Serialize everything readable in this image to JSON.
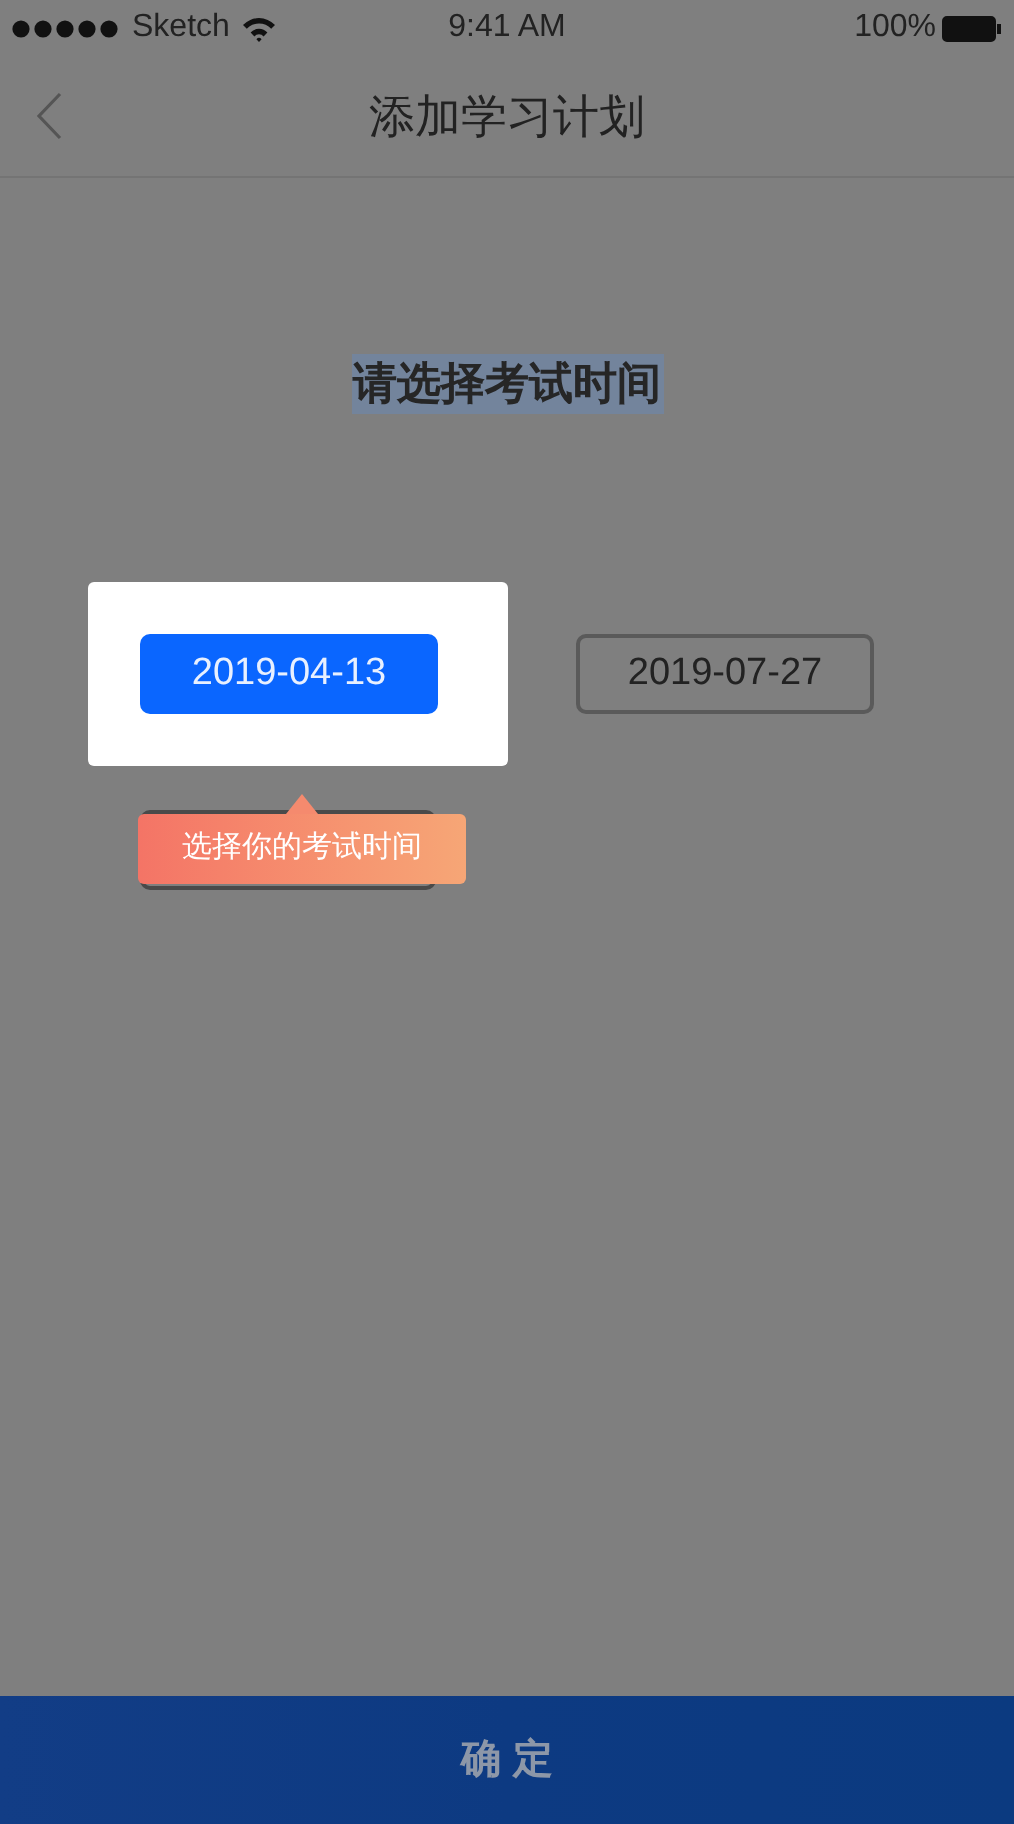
{
  "status_bar": {
    "carrier": "Sketch",
    "time": "9:41 AM",
    "battery": "100%"
  },
  "nav": {
    "title": "添加学习计划"
  },
  "heading": "请选择考试时间",
  "dates": [
    {
      "label": "2019-04-13",
      "selected": true
    },
    {
      "label": "2019-07-27",
      "selected": false
    }
  ],
  "tooltip": "选择你的考试时间",
  "confirm_button": "确 定"
}
